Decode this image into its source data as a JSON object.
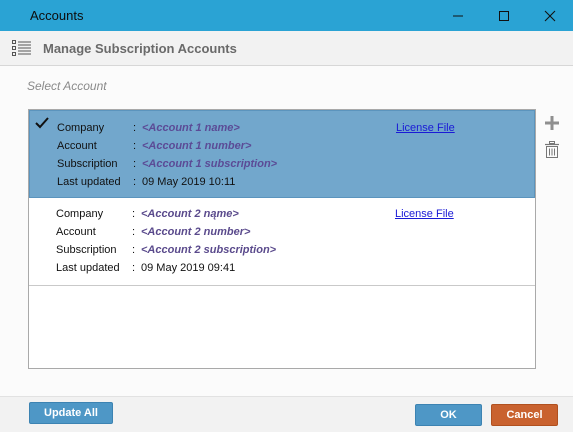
{
  "window": {
    "title": "Accounts"
  },
  "header": {
    "title": "Manage Subscription Accounts"
  },
  "select_label": "Select Account",
  "field_labels": {
    "company": "Company",
    "account": "Account",
    "subscription": "Subscription",
    "last_updated": "Last updated",
    "colon": ":"
  },
  "accounts": [
    {
      "company": "<Account 1 name>",
      "account": "<Account 1 number>",
      "subscription": "<Account 1 subscription>",
      "last_updated": "09 May 2019 10:11",
      "license": "License File",
      "selected": true
    },
    {
      "company": "<Account 2 nąme>",
      "account": "<Account 2 number>",
      "subscription": "<Account 2 subscription>",
      "last_updated": "09 May 2019 09:41",
      "license": "License File",
      "selected": false
    }
  ],
  "buttons": {
    "update_all": "Update All",
    "ok": "OK",
    "cancel": "Cancel"
  },
  "colors": {
    "titlebar": "#2aa3d4",
    "selected_row": "#72a7cc",
    "ok": "#4e97c6",
    "cancel": "#c9622f"
  }
}
